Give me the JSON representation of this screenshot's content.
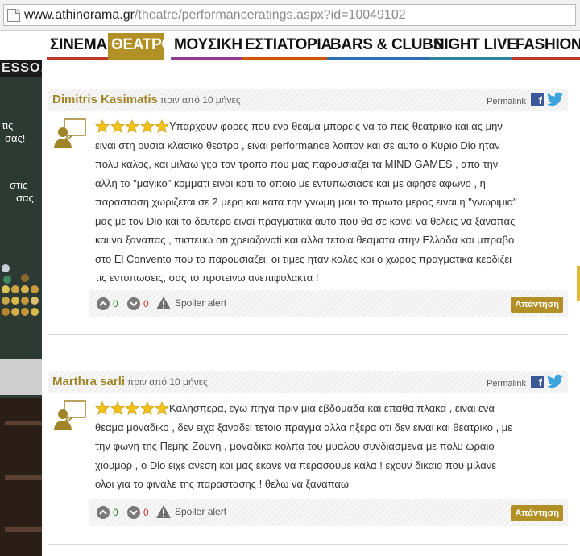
{
  "browser": {
    "url_host": "www.athinorama.gr",
    "url_path": "/theatre/performanceratings.aspx?id=10049102"
  },
  "nav": {
    "items": [
      {
        "label": "ΣΙΝΕΜΑ",
        "color": "#c0392b"
      },
      {
        "label": "ΘΕΑΤΡΟ",
        "color": "#b39025",
        "active": true
      },
      {
        "label": "ΜΟΥΣΙΚΗ",
        "color": "#8e3b8e"
      },
      {
        "label": "ΕΣΤΙΑΤΟΡΙΑ",
        "color": "#d35400"
      },
      {
        "label": "BARS & CLUBS",
        "color": "#2c6fb3"
      },
      {
        "label": "NIGHT LIVE",
        "color": "#2c8a9e"
      },
      {
        "label": "FASHION &",
        "color": "#c0392b"
      }
    ]
  },
  "left_ad": {
    "top_text": "ESSO.",
    "lines": [
      "τις",
      "σας!",
      "στις",
      "σας"
    ]
  },
  "reviews": [
    {
      "author": "Dimitris Kasimatis",
      "ago": "πριν από 10 μήνες",
      "permalink": "Permalink",
      "rating": 5,
      "lines": [
        "Υπαρχουν φορες που ενα θεαμα μπορεις να το πεις θεατρικο και ας μην",
        "ειναι στη ουσια κλασικο θεατρο , ειναι performance λοιπον και σε αυτο ο Κυριο Dio ηταν",
        "πολυ καλος, και μιλαω γι;α τον τροπο που μας παρουσιαζει τα MIND GAMES , απο την",
        "αλλη το \"μαγικο\" κομματι ειναι κατι το οποιο με εντυπωσιασε και με αφησε αφωνο , η",
        "παρασταση χωριζεται σε 2 μερη και κατα την γνωμη μου το πρωτο μερος ειναι η \"γνωριμια\"",
        "μας με τον Dio και το δευτερο ειναι πραγματικα αυτο που θα σε κανει να θελεις να ξαναπας",
        "και να ξαναπας , πιστευω οτι χρειαζοναti και αλλα τετοια θεαματα στην Ελλαδα και μπραβο",
        "στο El Convento που το παρουσιαζει, οι τιμες ηταν καλες και ο χωρος πραγματικα κερδιζει",
        "τις εντυπωσεις, σας το προτεινω ανεπιφυλακτα !"
      ],
      "up_votes": "0",
      "down_votes": "0",
      "spoiler": "Spoiler alert",
      "reply": "Απάντηση"
    },
    {
      "author": "Marthra sarli",
      "ago": "πριν από 10 μήνες",
      "permalink": "Permalink",
      "rating": 5,
      "lines": [
        "Καλησπερα, εγω πηγα πριν μια εβδομαδα και επαθα πλακα , ειναι ενα",
        "θεαμα μοναδικο , δεν ειχα ξαναδει τετοιο πραγμα αλλα ηξερα οτι δεν ειναι και θεατρικο , με",
        "την φωνη της Πεμης Ζουνη , μοναδικα κολπα του μυαλου συνδιασμενα με πολυ ωραιο",
        "χιουμορ , ο Dio ειχε ανεση και μας εκανε να περασουμε καλα ! εχουν δικαιο που μιλανε",
        "ολοι για το φιναλε της παραστασης ! θελω να ξαναπαω"
      ],
      "up_votes": "0",
      "down_votes": "0",
      "spoiler": "Spoiler alert",
      "reply": "Απάντηση"
    }
  ]
}
